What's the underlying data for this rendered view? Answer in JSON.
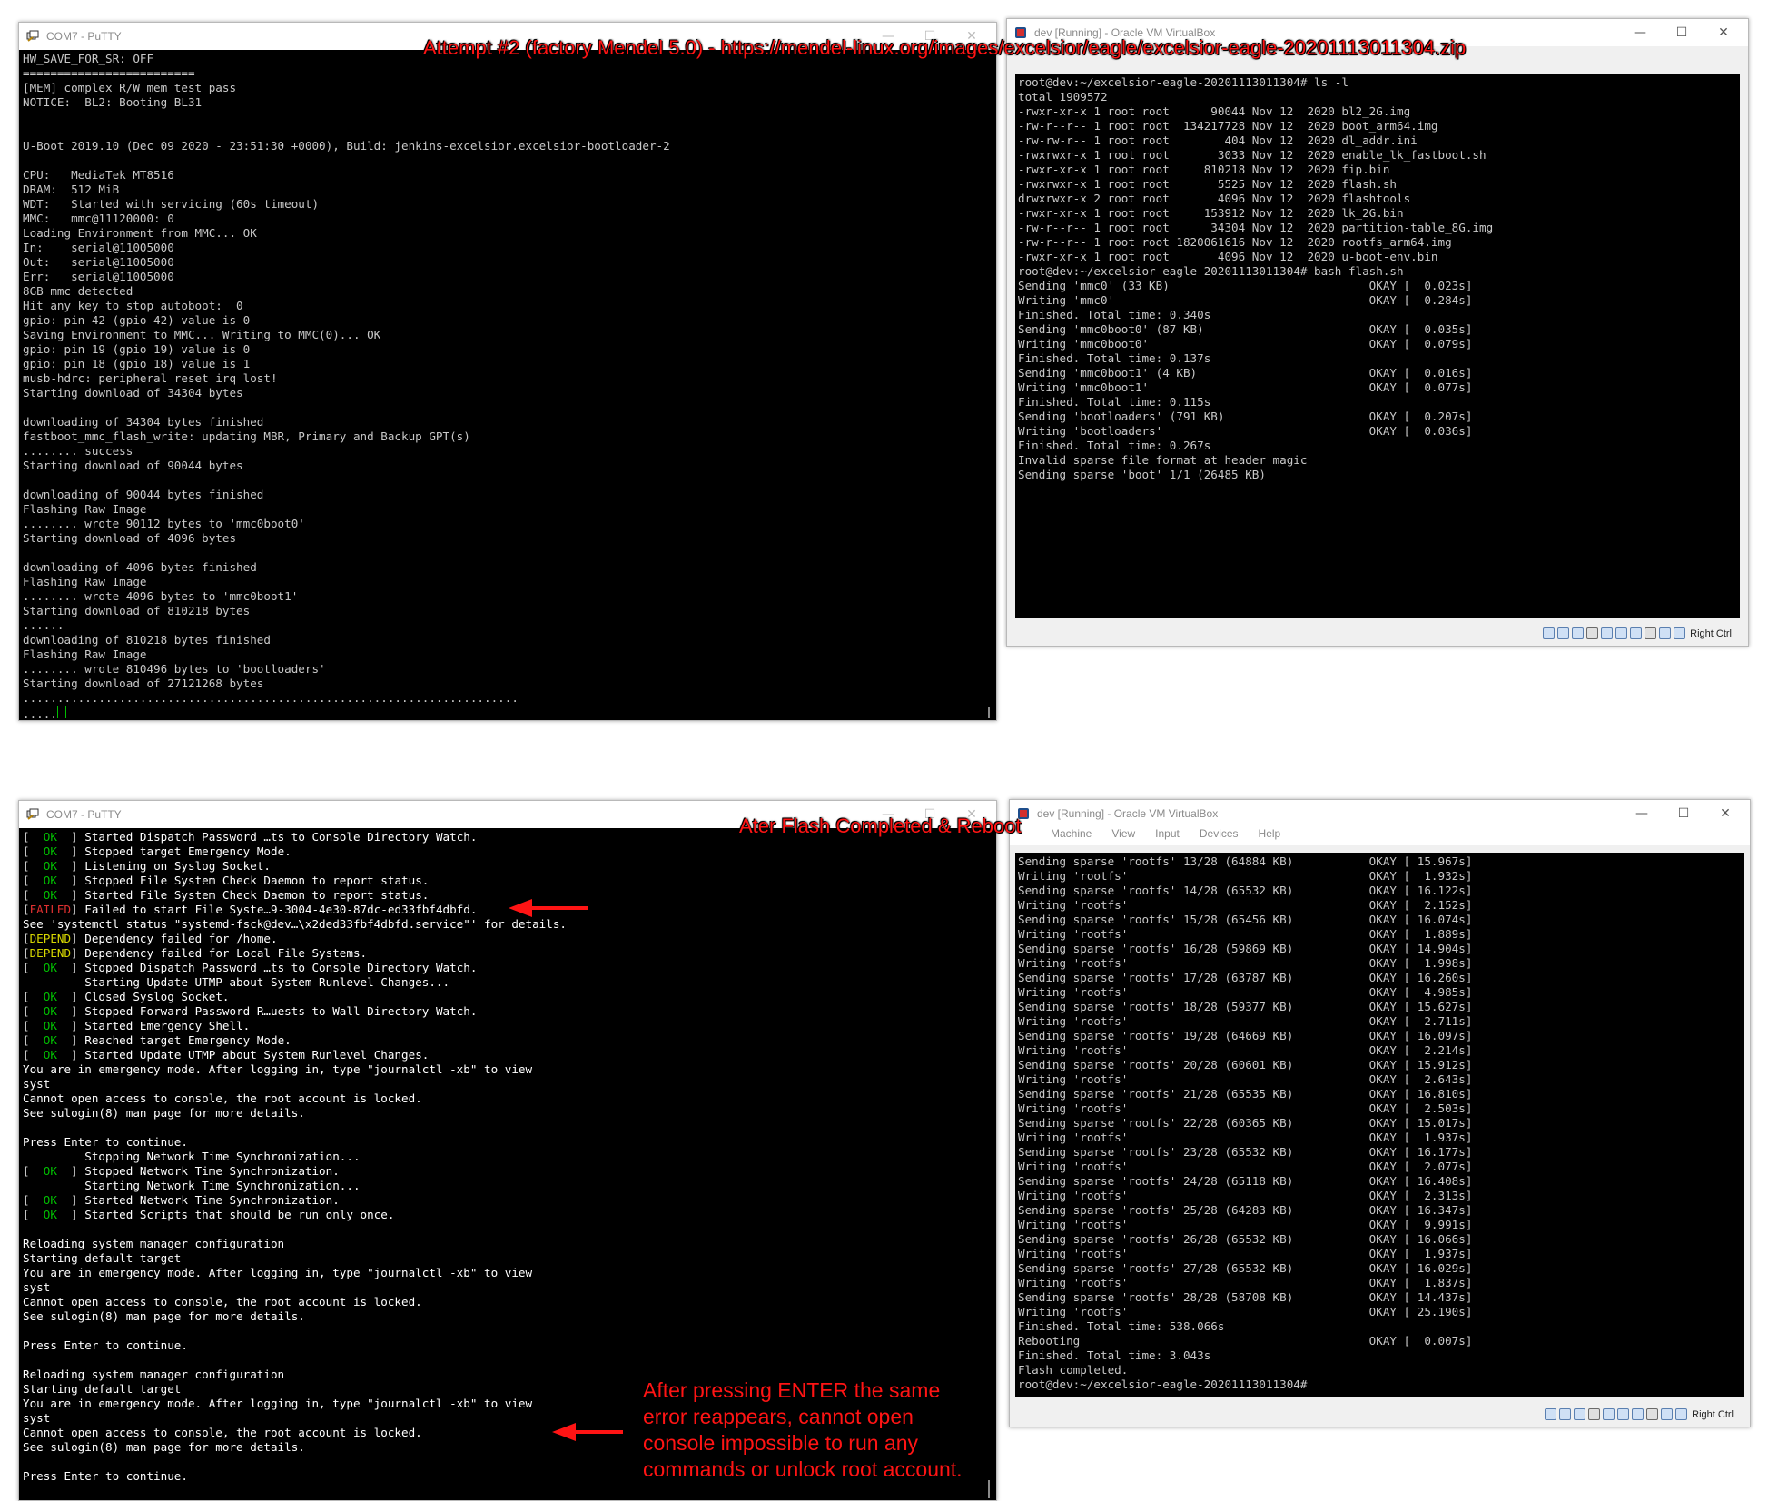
{
  "annotations": {
    "top": "Attempt #2 (factory Mendel 5.0) - https://mendel-linux.org/images/excelsior/eagle/excelsior-eagle-20201113011304.zip",
    "middle": "Ater Flash Completed & Reboot",
    "bottom": [
      "After pressing ENTER the same",
      "error reappears, cannot open",
      "console impossible to run any",
      "commands or unlock root account."
    ],
    "arrow_color": "#ff1414"
  },
  "putty_top": {
    "title": "COM7 - PuTTY",
    "icon": "putty-icon",
    "lines": [
      "HW_SAVE_FOR_SR: OFF",
      "=========================",
      "[MEM] complex R/W mem test pass",
      "NOTICE:  BL2: Booting BL31",
      "",
      "",
      "U-Boot 2019.10 (Dec 09 2020 - 23:51:30 +0000), Build: jenkins-excelsior.excelsior-bootloader-2",
      "",
      "CPU:   MediaTek MT8516",
      "DRAM:  512 MiB",
      "WDT:   Started with servicing (60s timeout)",
      "MMC:   mmc@11120000: 0",
      "Loading Environment from MMC... OK",
      "In:    serial@11005000",
      "Out:   serial@11005000",
      "Err:   serial@11005000",
      "8GB mmc detected",
      "Hit any key to stop autoboot:  0",
      "gpio: pin 42 (gpio 42) value is 0",
      "Saving Environment to MMC... Writing to MMC(0)... OK",
      "gpio: pin 19 (gpio 19) value is 0",
      "gpio: pin 18 (gpio 18) value is 1",
      "musb-hdrc: peripheral reset irq lost!",
      "Starting download of 34304 bytes",
      "",
      "downloading of 34304 bytes finished",
      "fastboot_mmc_flash_write: updating MBR, Primary and Backup GPT(s)",
      "........ success",
      "Starting download of 90044 bytes",
      "",
      "downloading of 90044 bytes finished",
      "Flashing Raw Image",
      "........ wrote 90112 bytes to 'mmc0boot0'",
      "Starting download of 4096 bytes",
      "",
      "downloading of 4096 bytes finished",
      "Flashing Raw Image",
      "........ wrote 4096 bytes to 'mmc0boot1'",
      "Starting download of 810218 bytes",
      "......",
      "downloading of 810218 bytes finished",
      "Flashing Raw Image",
      "........ wrote 810496 bytes to 'bootloaders'",
      "Starting download of 27121268 bytes",
      "........................................................................"
    ],
    "last_line": "....."
  },
  "vbox_top": {
    "title": "dev [Running] - Oracle VM VirtualBox",
    "host_key": "Right Ctrl",
    "lines": [
      "root@dev:~/excelsior-eagle-20201113011304# ls -l",
      "total 1909572",
      "-rwxr-xr-x 1 root root      90044 Nov 12  2020 bl2_2G.img",
      "-rw-r--r-- 1 root root  134217728 Nov 12  2020 boot_arm64.img",
      "-rw-rw-r-- 1 root root        404 Nov 12  2020 dl_addr.ini",
      "-rwxrwxr-x 1 root root       3033 Nov 12  2020 enable_lk_fastboot.sh",
      "-rwxr-xr-x 1 root root     810218 Nov 12  2020 fip.bin",
      "-rwxrwxr-x 1 root root       5525 Nov 12  2020 flash.sh",
      "drwxrwxr-x 2 root root       4096 Nov 12  2020 flashtools",
      "-rwxr-xr-x 1 root root     153912 Nov 12  2020 lk_2G.bin",
      "-rw-r--r-- 1 root root      34304 Nov 12  2020 partition-table_8G.img",
      "-rw-r--r-- 1 root root 1820061616 Nov 12  2020 rootfs_arm64.img",
      "-rwxr-xr-x 1 root root       4096 Nov 12  2020 u-boot-env.bin",
      "root@dev:~/excelsior-eagle-20201113011304# bash flash.sh",
      "Sending 'mmc0' (33 KB)                             OKAY [  0.023s]",
      "Writing 'mmc0'                                     OKAY [  0.284s]",
      "Finished. Total time: 0.340s",
      "Sending 'mmc0boot0' (87 KB)                        OKAY [  0.035s]",
      "Writing 'mmc0boot0'                                OKAY [  0.079s]",
      "Finished. Total time: 0.137s",
      "Sending 'mmc0boot1' (4 KB)                         OKAY [  0.016s]",
      "Writing 'mmc0boot1'                                OKAY [  0.077s]",
      "Finished. Total time: 0.115s",
      "Sending 'bootloaders' (791 KB)                     OKAY [  0.207s]",
      "Writing 'bootloaders'                              OKAY [  0.036s]",
      "Finished. Total time: 0.267s",
      "Invalid sparse file format at header magic",
      "Sending sparse 'boot' 1/1 (26485 KB)"
    ]
  },
  "putty_bottom": {
    "title": "COM7 - PuTTY",
    "lines": [
      {
        "tag": "ok",
        "text": " Started Dispatch Password …ts to Console Directory Watch."
      },
      {
        "tag": "ok",
        "text": " Stopped target Emergency Mode."
      },
      {
        "tag": "ok",
        "text": " Listening on Syslog Socket."
      },
      {
        "tag": "ok",
        "text": " Stopped File System Check Daemon to report status."
      },
      {
        "tag": "ok",
        "text": " Started File System Check Daemon to report status."
      },
      {
        "tag": "failed",
        "text": " Failed to start File Syste…9-3004-4e30-87dc-ed33fbf4dbfd."
      },
      {
        "tag": "",
        "text": "See 'systemctl status \"systemd-fsck@dev…\\x2ded33fbf4dbfd.service\"' for details."
      },
      {
        "tag": "depend",
        "text": " Dependency failed for /home."
      },
      {
        "tag": "depend",
        "text": " Dependency failed for Local File Systems."
      },
      {
        "tag": "ok",
        "text": " Stopped Dispatch Password …ts to Console Directory Watch."
      },
      {
        "tag": "",
        "text": "         Starting Update UTMP about System Runlevel Changes..."
      },
      {
        "tag": "ok",
        "text": " Closed Syslog Socket."
      },
      {
        "tag": "ok",
        "text": " Stopped Forward Password R…uests to Wall Directory Watch."
      },
      {
        "tag": "ok",
        "text": " Started Emergency Shell."
      },
      {
        "tag": "ok",
        "text": " Reached target Emergency Mode."
      },
      {
        "tag": "ok",
        "text": " Started Update UTMP about System Runlevel Changes."
      },
      {
        "tag": "",
        "text": "You are in emergency mode. After logging in, type \"journalctl -xb\" to view"
      },
      {
        "tag": "",
        "text": "syst"
      },
      {
        "tag": "",
        "text": "Cannot open access to console, the root account is locked."
      },
      {
        "tag": "",
        "text": "See sulogin(8) man page for more details."
      },
      {
        "tag": "",
        "text": ""
      },
      {
        "tag": "",
        "text": "Press Enter to continue."
      },
      {
        "tag": "",
        "text": "         Stopping Network Time Synchronization..."
      },
      {
        "tag": "ok",
        "text": " Stopped Network Time Synchronization."
      },
      {
        "tag": "",
        "text": "         Starting Network Time Synchronization..."
      },
      {
        "tag": "ok",
        "text": " Started Network Time Synchronization."
      },
      {
        "tag": "ok",
        "text": " Started Scripts that should be run only once."
      },
      {
        "tag": "",
        "text": ""
      },
      {
        "tag": "",
        "text": "Reloading system manager configuration"
      },
      {
        "tag": "",
        "text": "Starting default target"
      },
      {
        "tag": "",
        "text": "You are in emergency mode. After logging in, type \"journalctl -xb\" to view"
      },
      {
        "tag": "",
        "text": "syst"
      },
      {
        "tag": "",
        "text": "Cannot open access to console, the root account is locked."
      },
      {
        "tag": "",
        "text": "See sulogin(8) man page for more details."
      },
      {
        "tag": "",
        "text": ""
      },
      {
        "tag": "",
        "text": "Press Enter to continue."
      },
      {
        "tag": "",
        "text": ""
      },
      {
        "tag": "",
        "text": "Reloading system manager configuration"
      },
      {
        "tag": "",
        "text": "Starting default target"
      },
      {
        "tag": "",
        "text": "You are in emergency mode. After logging in, type \"journalctl -xb\" to view"
      },
      {
        "tag": "",
        "text": "syst"
      },
      {
        "tag": "",
        "text": "Cannot open access to console, the root account is locked."
      },
      {
        "tag": "",
        "text": "See sulogin(8) man page for more details."
      },
      {
        "tag": "",
        "text": ""
      },
      {
        "tag": "",
        "text": "Press Enter to continue."
      }
    ],
    "tags": {
      "ok": "  OK  ",
      "failed": "FAILED",
      "depend": "DEPEND"
    }
  },
  "vbox_bottom": {
    "title": "dev [Running] - Oracle VM VirtualBox",
    "menu": [
      "Machine",
      "View",
      "Input",
      "Devices",
      "Help"
    ],
    "host_key": "Right Ctrl",
    "lines": [
      "Sending sparse 'rootfs' 13/28 (64884 KB)           OKAY [ 15.967s]",
      "Writing 'rootfs'                                   OKAY [  1.932s]",
      "Sending sparse 'rootfs' 14/28 (65532 KB)           OKAY [ 16.122s]",
      "Writing 'rootfs'                                   OKAY [  2.152s]",
      "Sending sparse 'rootfs' 15/28 (65456 KB)           OKAY [ 16.074s]",
      "Writing 'rootfs'                                   OKAY [  1.889s]",
      "Sending sparse 'rootfs' 16/28 (59869 KB)           OKAY [ 14.904s]",
      "Writing 'rootfs'                                   OKAY [  1.998s]",
      "Sending sparse 'rootfs' 17/28 (63787 KB)           OKAY [ 16.260s]",
      "Writing 'rootfs'                                   OKAY [  4.985s]",
      "Sending sparse 'rootfs' 18/28 (59377 KB)           OKAY [ 15.627s]",
      "Writing 'rootfs'                                   OKAY [  2.711s]",
      "Sending sparse 'rootfs' 19/28 (64669 KB)           OKAY [ 16.097s]",
      "Writing 'rootfs'                                   OKAY [  2.214s]",
      "Sending sparse 'rootfs' 20/28 (60601 KB)           OKAY [ 15.912s]",
      "Writing 'rootfs'                                   OKAY [  2.643s]",
      "Sending sparse 'rootfs' 21/28 (65535 KB)           OKAY [ 16.810s]",
      "Writing 'rootfs'                                   OKAY [  2.503s]",
      "Sending sparse 'rootfs' 22/28 (60365 KB)           OKAY [ 15.017s]",
      "Writing 'rootfs'                                   OKAY [  1.937s]",
      "Sending sparse 'rootfs' 23/28 (65532 KB)           OKAY [ 16.177s]",
      "Writing 'rootfs'                                   OKAY [  2.077s]",
      "Sending sparse 'rootfs' 24/28 (65118 KB)           OKAY [ 16.408s]",
      "Writing 'rootfs'                                   OKAY [  2.313s]",
      "Sending sparse 'rootfs' 25/28 (64283 KB)           OKAY [ 16.347s]",
      "Writing 'rootfs'                                   OKAY [  9.991s]",
      "Sending sparse 'rootfs' 26/28 (65532 KB)           OKAY [ 16.066s]",
      "Writing 'rootfs'                                   OKAY [  1.937s]",
      "Sending sparse 'rootfs' 27/28 (65532 KB)           OKAY [ 16.029s]",
      "Writing 'rootfs'                                   OKAY [  1.837s]",
      "Sending sparse 'rootfs' 28/28 (58708 KB)           OKAY [ 14.437s]",
      "Writing 'rootfs'                                   OKAY [ 25.190s]",
      "Finished. Total time: 538.066s",
      "Rebooting                                          OKAY [  0.007s]",
      "Finished. Total time: 3.043s",
      "Flash completed.",
      "root@dev:~/excelsior-eagle-20201113011304#"
    ]
  },
  "window_controls": {
    "minimize": "—",
    "maximize": "☐",
    "close": "✕"
  }
}
